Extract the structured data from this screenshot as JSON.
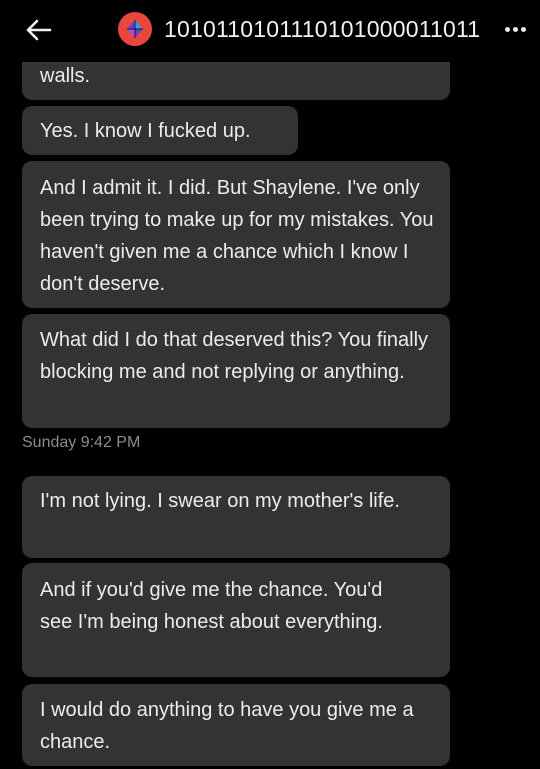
{
  "header": {
    "back_icon": "arrow-left-icon",
    "avatar_icon": "diamond-logo-icon",
    "avatar_color": "#e9473d",
    "title": "1010110101110101000011011",
    "more_icon": "more-dots-icon"
  },
  "messages": [
    {
      "text": "walls."
    },
    {
      "text": "Yes. I know I fucked up."
    },
    {
      "text": "And I admit it. I did. But Shaylene. I've only been trying to make up for my mistakes. You haven't given me a chance which I know I don't deserve."
    },
    {
      "text": "What did I do that deserved this? You finally blocking me and not replying or anything."
    },
    {
      "text": "I'm not lying. I swear on my mother's life."
    },
    {
      "text": "And if you'd give me the chance. You'd see I'm being honest about everything."
    },
    {
      "text": "I would do anything to have you give me a chance."
    }
  ],
  "timestamp": "Sunday 9:42 PM",
  "colors": {
    "background": "#000000",
    "bubble": "#333333",
    "text": "#ececec",
    "timestamp": "#8c8c8c"
  }
}
